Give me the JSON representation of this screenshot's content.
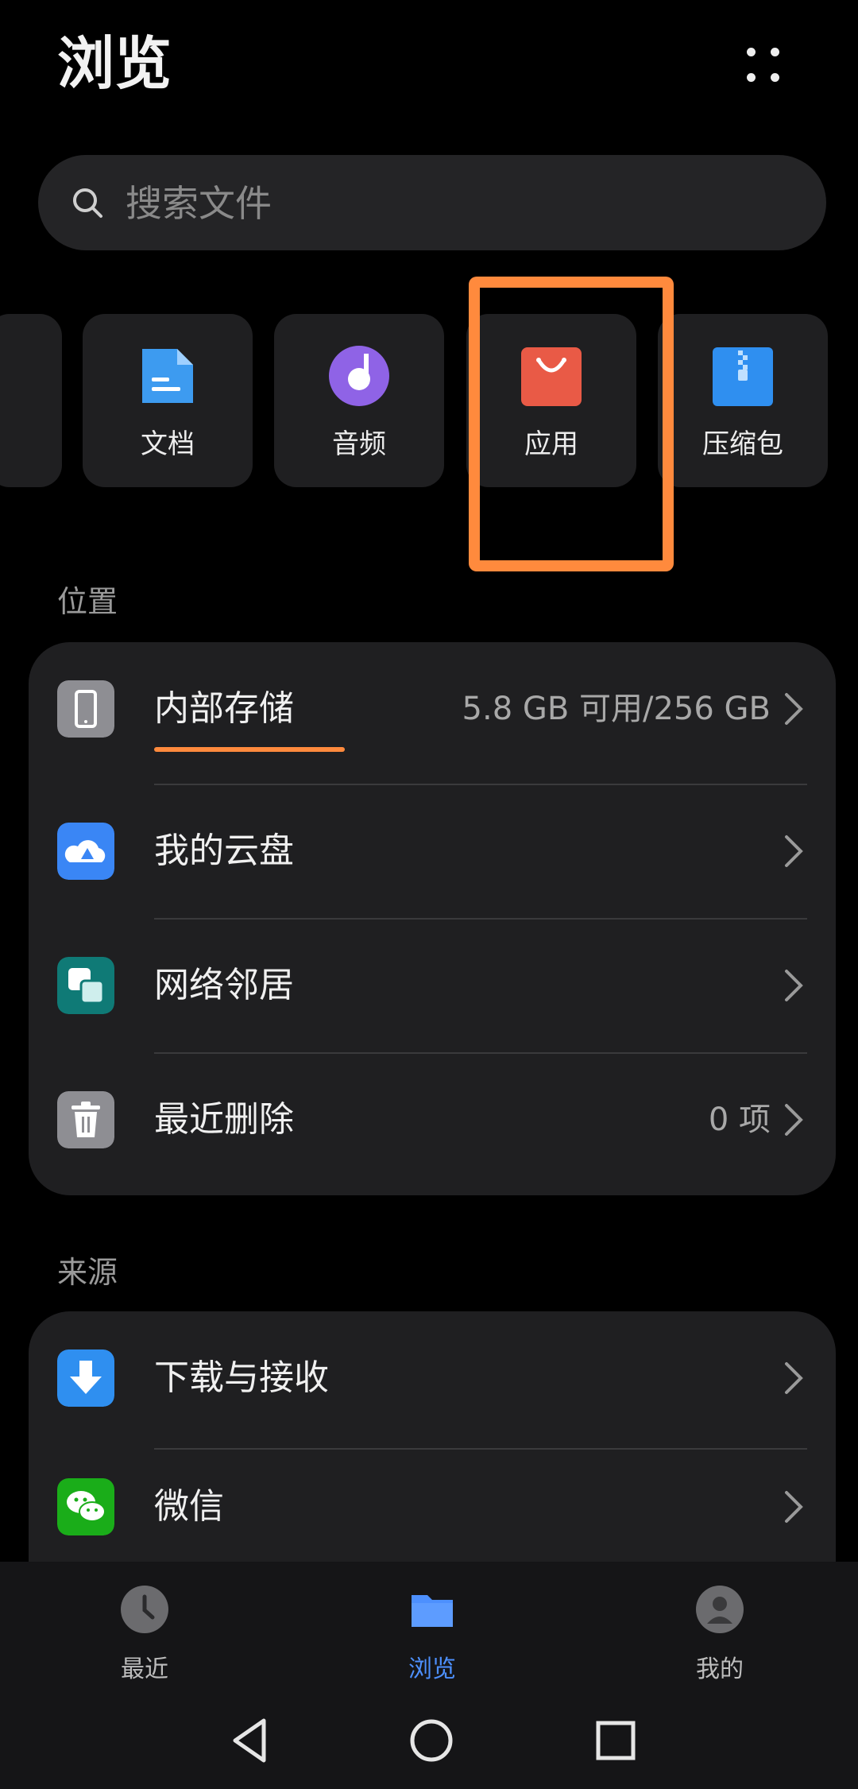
{
  "header": {
    "title": "浏览"
  },
  "search": {
    "placeholder": "搜索文件"
  },
  "categories": [
    {
      "label": "文档",
      "icon": "document-icon",
      "color": "#3d9bf0"
    },
    {
      "label": "音频",
      "icon": "audio-icon",
      "color": "#8f63e6"
    },
    {
      "label": "应用",
      "icon": "app-bag-icon",
      "color": "#e95a46"
    },
    {
      "label": "压缩包",
      "icon": "archive-icon",
      "color": "#2f8ff0"
    }
  ],
  "locations": {
    "title": "位置",
    "items": [
      {
        "label": "内部存储",
        "value": "5.8 GB 可用/256 GB",
        "icon": "phone-icon"
      },
      {
        "label": "我的云盘",
        "value": "",
        "icon": "cloud-icon"
      },
      {
        "label": "网络邻居",
        "value": "",
        "icon": "network-icon"
      },
      {
        "label": "最近删除",
        "value": "0 项",
        "icon": "trash-icon"
      }
    ]
  },
  "sources": {
    "title": "来源",
    "items": [
      {
        "label": "下载与接收",
        "icon": "download-icon"
      },
      {
        "label": "微信",
        "icon": "wechat-icon"
      }
    ]
  },
  "bottom_nav": [
    {
      "label": "最近",
      "icon": "clock-icon",
      "active": false
    },
    {
      "label": "浏览",
      "icon": "folder-icon",
      "active": true
    },
    {
      "label": "我的",
      "icon": "profile-icon",
      "active": false
    }
  ],
  "colors": {
    "accent": "#4d90fe",
    "highlight": "#ff8a3d",
    "usage_bar": "#ff8a3d"
  }
}
